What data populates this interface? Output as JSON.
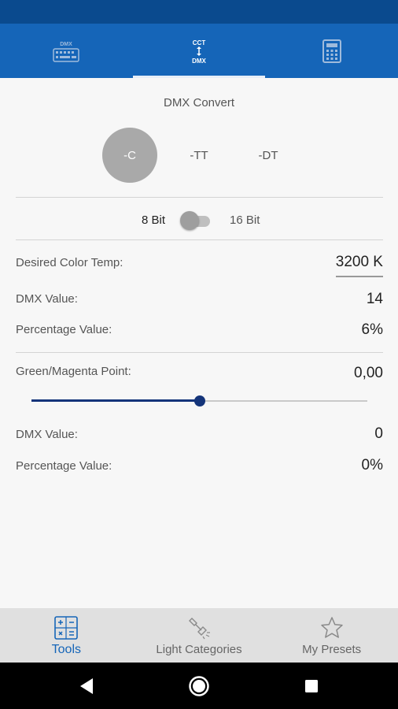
{
  "tabs": [
    {
      "name": "DMX",
      "icon": "dmx-keyboard-icon",
      "active": false
    },
    {
      "name": "CCT to DMX",
      "icon": "cct-dmx-icon",
      "text_top": "CCT",
      "text_bottom": "DMX",
      "active": true
    },
    {
      "name": "Calculator",
      "icon": "calculator-icon",
      "active": false
    }
  ],
  "tab_icon_text": {
    "dmx": "DMX"
  },
  "title": "DMX Convert",
  "modes": [
    "-C",
    "-TT",
    "-DT"
  ],
  "active_mode": "-C",
  "bits": {
    "label_8": "8 Bit",
    "label_16": "16 Bit",
    "is_16": false
  },
  "color_temp": {
    "label": "Desired Color Temp:",
    "value": "3200 K",
    "dmx_label": "DMX Value:",
    "dmx_value": "14",
    "pct_label": "Percentage Value:",
    "pct_value": "6%"
  },
  "green_magenta": {
    "label": "Green/Magenta Point:",
    "value": "0,00",
    "slider_fraction": 0.5,
    "dmx_label": "DMX Value:",
    "dmx_value": "0",
    "pct_label": "Percentage Value:",
    "pct_value": "0%"
  },
  "bottom_nav": [
    {
      "label": "Tools",
      "icon": "tools-icon",
      "active": true
    },
    {
      "label": "Light Categories",
      "icon": "light-categories-icon",
      "active": false
    },
    {
      "label": "My Presets",
      "icon": "star-icon",
      "active": false
    }
  ],
  "colors": {
    "primary": "#1565b8",
    "status_bar": "#0a4a8e",
    "slider": "#14347a",
    "active_mode_bg": "#a9a9a9"
  }
}
